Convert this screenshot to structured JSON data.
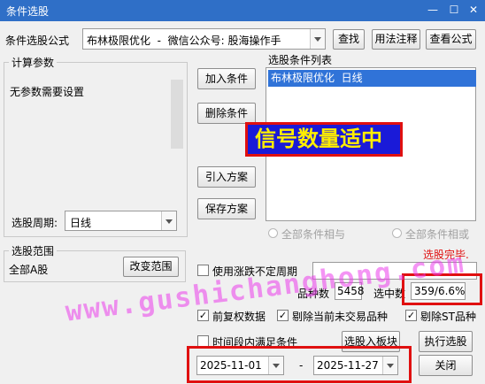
{
  "window": {
    "title": "条件选股"
  },
  "formula": {
    "label": "条件选股公式",
    "value": "布林极限优化  -  微信公众号: 股海操作手",
    "find_btn": "查找",
    "usage_btn": "用法注释",
    "view_btn": "查看公式"
  },
  "params": {
    "title": "计算参数",
    "text": "无参数需要设置",
    "period_label": "选股周期:",
    "period_value": "日线"
  },
  "actions": {
    "add": "加入条件",
    "delete": "删除条件",
    "import": "引入方案",
    "save": "保存方案"
  },
  "conditions": {
    "title": "选股条件列表",
    "items": [
      "布林极限优化  日线"
    ]
  },
  "overlay": {
    "text": "信号数量适中"
  },
  "logic": {
    "and": "全部条件相与",
    "or": "全部条件相或"
  },
  "status": {
    "text": "选股完毕."
  },
  "range": {
    "title": "选股范围",
    "value": "全部A股",
    "change_btn": "改变范围"
  },
  "uncertain": {
    "label": "使用涨跌不定周期"
  },
  "stats": {
    "count_label": "品种数",
    "count": "5458",
    "selected_label": "选中数",
    "selected": "359/6.6%"
  },
  "options": {
    "fq": "前复权数据",
    "exclude_untraded": "剔除当前未交易品种",
    "exclude_st": "剔除ST品种",
    "period_cond": "时间段内满足条件"
  },
  "buttons": {
    "to_block": "选股入板块",
    "execute": "执行选股",
    "close": "关闭"
  },
  "dates": {
    "start": "2025-11-01",
    "sep": "-",
    "end": "2025-11-27"
  },
  "watermark": "www.gushichanghong.com",
  "colors": {
    "accent": "#e01010",
    "titlebar": "#2f6fc7",
    "overlay_bg": "#1a1ad8",
    "overlay_fg": "#ffee00"
  }
}
